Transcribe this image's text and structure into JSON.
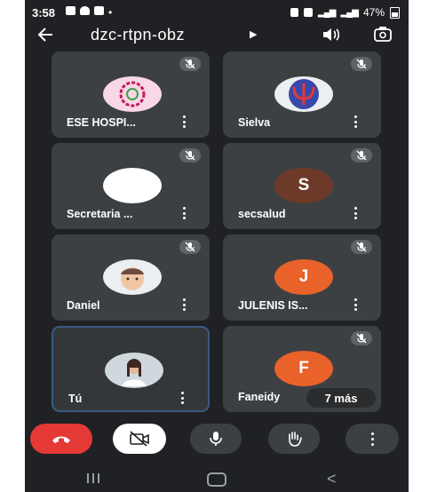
{
  "status": {
    "time": "3:58",
    "battery": "47%"
  },
  "meeting": {
    "code": "dzc-rtpn-obz"
  },
  "participants": [
    {
      "name": "ESE HOSPI...",
      "avatar": "logo-gear",
      "color": "#f8d7e6"
    },
    {
      "name": "Sielva",
      "avatar": "logo-psi",
      "color": "#2a2f8f"
    },
    {
      "name": "Secretaria ...",
      "avatar": "blank",
      "color": "#ffffff"
    },
    {
      "name": "secsalud",
      "avatar": "S",
      "color": "#6d3a2a"
    },
    {
      "name": "Daniel",
      "avatar": "memoji",
      "color": "#eceff1"
    },
    {
      "name": "JULENIS IS...",
      "avatar": "J",
      "color": "#e8622a"
    },
    {
      "name": "Tú",
      "avatar": "photo",
      "color": "#cfd8dc"
    },
    {
      "name": "Faneidy",
      "avatar": "F",
      "color": "#e8622a"
    }
  ],
  "more_participants": "7 más",
  "controls": {
    "end_call_color": "#e53935",
    "camera_off_bg": "#ffffff"
  },
  "icons": {
    "back": "arrow-left-icon",
    "speaker": "speaker-icon",
    "switch_camera": "switch-camera-icon",
    "mute": "mic-off-icon",
    "more": "more-vert-icon"
  }
}
